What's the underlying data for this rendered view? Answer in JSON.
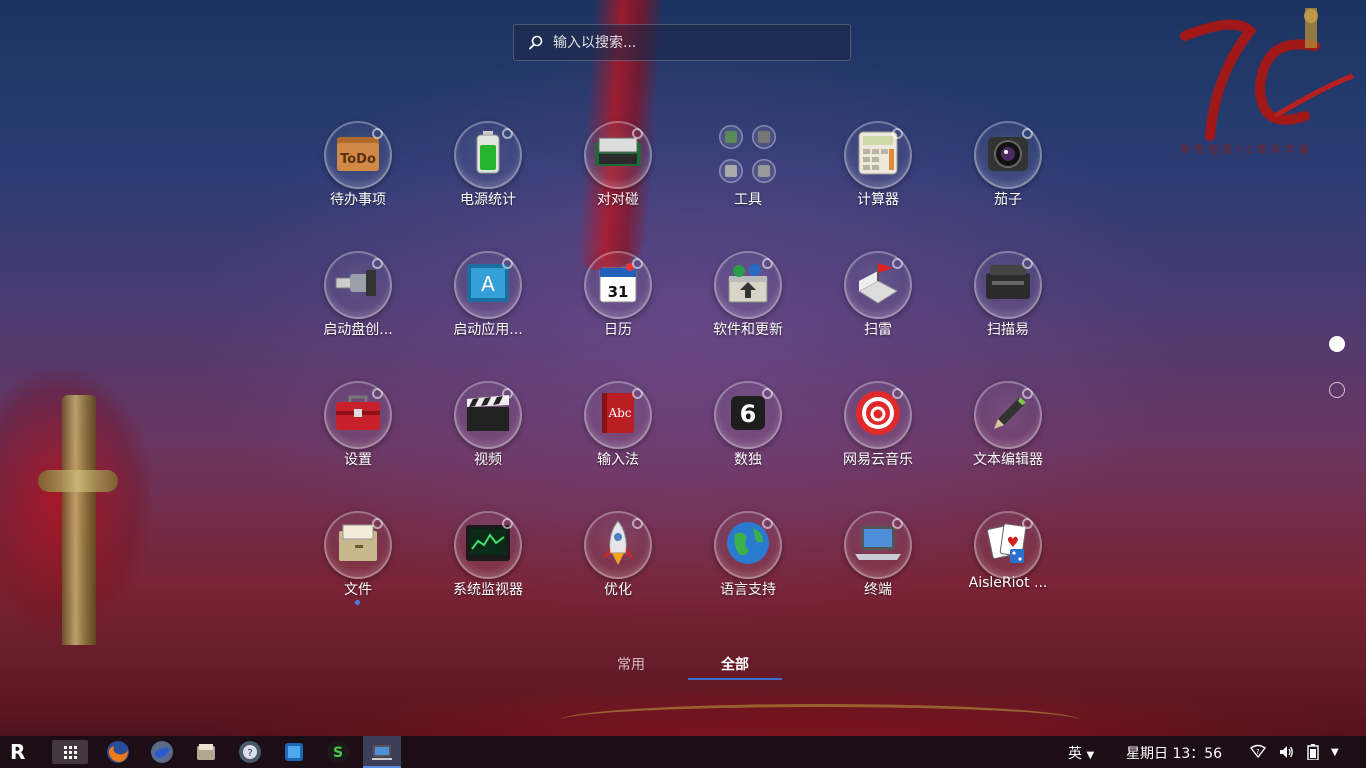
{
  "search": {
    "placeholder": "输入以搜索..."
  },
  "logo": {
    "caption": "恭贺祖国70周年华诞"
  },
  "apps": [
    {
      "label": "待办事项",
      "icon": "todo-folder-icon"
    },
    {
      "label": "电源统计",
      "icon": "battery-icon"
    },
    {
      "label": "对对碰",
      "icon": "mahjong-tiles-icon"
    },
    {
      "label": "工具",
      "icon": "tools-folder-icon"
    },
    {
      "label": "计算器",
      "icon": "calculator-icon"
    },
    {
      "label": "茄子",
      "icon": "webcam-icon"
    },
    {
      "label": "启动盘创...",
      "icon": "usb-drive-icon"
    },
    {
      "label": "启动应用...",
      "icon": "startup-apps-icon"
    },
    {
      "label": "日历",
      "icon": "calendar-icon"
    },
    {
      "label": "软件和更新",
      "icon": "software-update-icon"
    },
    {
      "label": "扫雷",
      "icon": "minesweeper-flag-icon"
    },
    {
      "label": "扫描易",
      "icon": "scanner-icon"
    },
    {
      "label": "设置",
      "icon": "toolbox-icon"
    },
    {
      "label": "视频",
      "icon": "clapperboard-icon"
    },
    {
      "label": "输入法",
      "icon": "abc-book-icon"
    },
    {
      "label": "数独",
      "icon": "sudoku-icon"
    },
    {
      "label": "网易云音乐",
      "icon": "netease-music-icon"
    },
    {
      "label": "文本编辑器",
      "icon": "pen-icon"
    },
    {
      "label": "文件",
      "icon": "file-cabinet-icon"
    },
    {
      "label": "系统监视器",
      "icon": "system-monitor-icon"
    },
    {
      "label": "优化",
      "icon": "rocket-icon"
    },
    {
      "label": "语言支持",
      "icon": "globe-icon"
    },
    {
      "label": "终端",
      "icon": "laptop-icon"
    },
    {
      "label": "AisleRiot ...",
      "icon": "playing-cards-icon"
    }
  ],
  "tabs": [
    {
      "label": "常用",
      "active": false
    },
    {
      "label": "全部",
      "active": true
    }
  ],
  "pages": {
    "count": 2,
    "current": 1
  },
  "taskbar": {
    "start_label": "R",
    "pinned": [
      "firefox-icon",
      "thunderbird-icon",
      "files-icon",
      "help-icon",
      "virtualbox-icon",
      "wps-icon",
      "launcher-active-icon"
    ],
    "input_method": "英",
    "clock": "星期日 13：56",
    "tray": [
      "network-icon",
      "volume-icon",
      "battery-tray-icon",
      "menu-arrow-icon"
    ]
  },
  "colors": {
    "accent": "#3d6fd0",
    "running_dot": "#4a7fe0"
  }
}
